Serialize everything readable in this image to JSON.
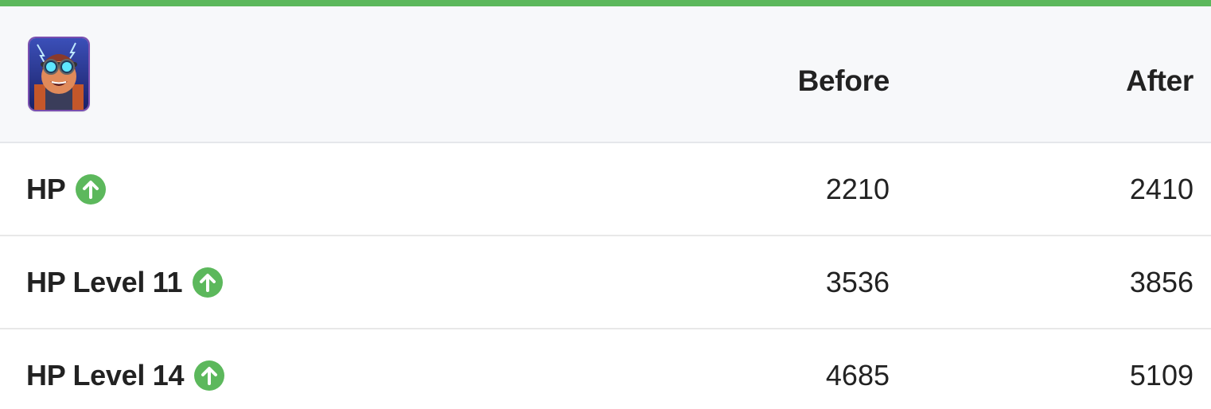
{
  "accent_color": "#5cb85c",
  "header": {
    "card_icon": "electro-giant-card-icon",
    "before_label": "Before",
    "after_label": "After"
  },
  "rows": [
    {
      "label": "HP",
      "change_icon": "arrow-up-circle-icon",
      "before": "2210",
      "after": "2410"
    },
    {
      "label": "HP Level 11",
      "change_icon": "arrow-up-circle-icon",
      "before": "3536",
      "after": "3856"
    },
    {
      "label": "HP Level 14",
      "change_icon": "arrow-up-circle-icon",
      "before": "4685",
      "after": "5109"
    }
  ]
}
